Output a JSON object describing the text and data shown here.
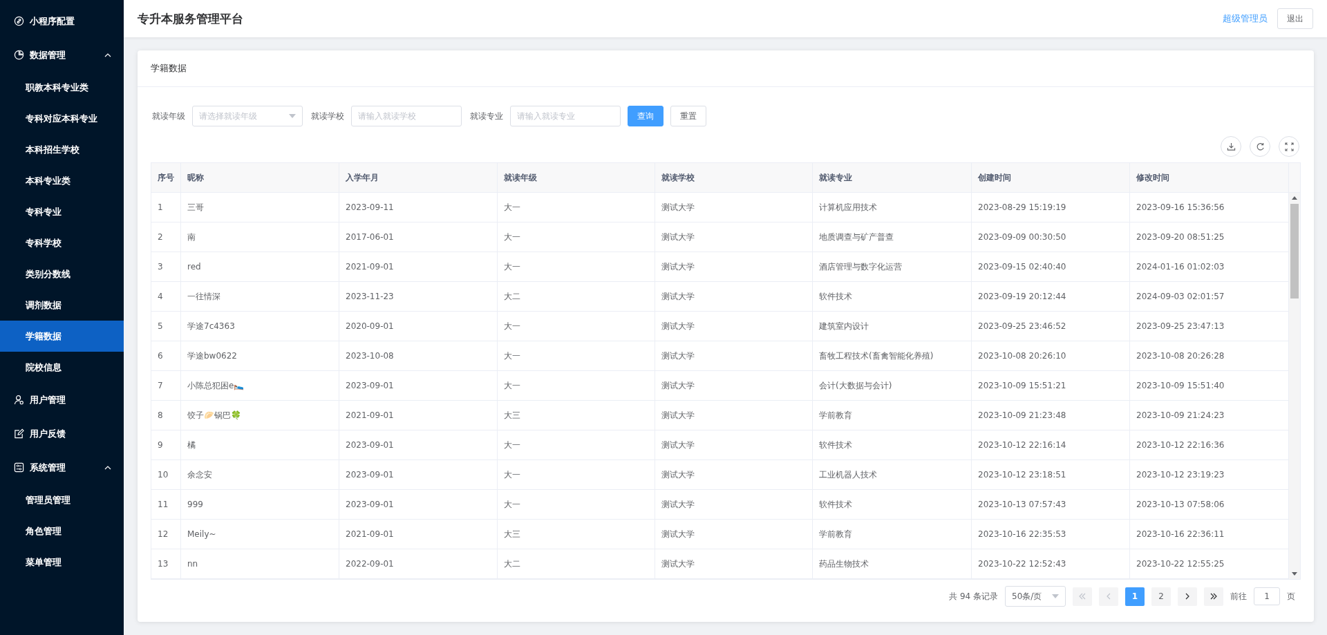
{
  "sidebar": {
    "items": [
      {
        "label": "小程序配置"
      },
      {
        "label": "数据管理",
        "expanded": true,
        "children": [
          {
            "label": "职教本科专业类",
            "selected": false
          },
          {
            "label": "专科对应本科专业",
            "selected": false
          },
          {
            "label": "本科招生学校",
            "selected": false
          },
          {
            "label": "本科专业类",
            "selected": false
          },
          {
            "label": "专科专业",
            "selected": false
          },
          {
            "label": "专科学校",
            "selected": false
          },
          {
            "label": "类别分数线",
            "selected": false
          },
          {
            "label": "调剂数据",
            "selected": false
          },
          {
            "label": "学籍数据",
            "selected": true
          },
          {
            "label": "院校信息",
            "selected": false
          }
        ]
      },
      {
        "label": "用户管理"
      },
      {
        "label": "用户反馈"
      },
      {
        "label": "系统管理",
        "expanded": true,
        "children": [
          {
            "label": "管理员管理",
            "selected": false
          },
          {
            "label": "角色管理",
            "selected": false
          },
          {
            "label": "菜单管理",
            "selected": false
          }
        ]
      }
    ]
  },
  "header": {
    "title": "专升本服务管理平台",
    "user": "超级管理员",
    "logout": "退出"
  },
  "card": {
    "title": "学籍数据"
  },
  "filters": [
    {
      "kind": "select",
      "label": "就读年级",
      "placeholder": "请选择就读年级"
    },
    {
      "kind": "input",
      "label": "就读学校",
      "placeholder": "请输入就读学校"
    },
    {
      "kind": "input",
      "label": "就读专业",
      "placeholder": "请输入就读专业"
    }
  ],
  "buttons": [
    {
      "label": "查询",
      "primary": true
    },
    {
      "label": "重置",
      "primary": false
    }
  ],
  "table": {
    "columns": [
      "序号",
      "昵称",
      "入学年月",
      "就读年级",
      "就读学校",
      "就读专业",
      "创建时间",
      "修改时间"
    ],
    "rows": [
      [
        "1",
        "三哥",
        "2023-09-11",
        "大一",
        "测试大学",
        "计算机应用技术",
        "2023-08-29 15:19:19",
        "2023-09-16 15:36:56"
      ],
      [
        "2",
        "南",
        "2017-06-01",
        "大一",
        "测试大学",
        "地质调查与矿产普查",
        "2023-09-09 00:30:50",
        "2023-09-20 08:51:25"
      ],
      [
        "3",
        "red",
        "2021-09-01",
        "大一",
        "测试大学",
        "酒店管理与数字化运营",
        "2023-09-15 02:40:40",
        "2024-01-16 01:02:03"
      ],
      [
        "4",
        "一往情深",
        "2023-11-23",
        "大二",
        "测试大学",
        "软件技术",
        "2023-09-19 20:12:44",
        "2024-09-03 02:01:57"
      ],
      [
        "5",
        "学途7c4363",
        "2020-09-01",
        "大一",
        "测试大学",
        "建筑室内设计",
        "2023-09-25 23:46:52",
        "2023-09-25 23:47:13"
      ],
      [
        "6",
        "学途bw0622",
        "2023-10-08",
        "大一",
        "测试大学",
        "畜牧工程技术(畜禽智能化养殖)",
        "2023-10-08 20:26:10",
        "2023-10-08 20:26:28"
      ],
      [
        "7",
        "小陈总犯困e🛌",
        "2023-09-01",
        "大一",
        "测试大学",
        "会计(大数据与会计)",
        "2023-10-09 15:51:21",
        "2023-10-09 15:51:40"
      ],
      [
        "8",
        "饺子🥟锅巴🍀",
        "2021-09-01",
        "大三",
        "测试大学",
        "学前教育",
        "2023-10-09 21:23:48",
        "2023-10-09 21:24:23"
      ],
      [
        "9",
        "橘",
        "2023-09-01",
        "大一",
        "测试大学",
        "软件技术",
        "2023-10-12 22:16:14",
        "2023-10-12 22:16:36"
      ],
      [
        "10",
        "余念安",
        "2023-09-01",
        "大一",
        "测试大学",
        "工业机器人技术",
        "2023-10-12 23:18:51",
        "2023-10-12 23:19:23"
      ],
      [
        "11",
        "999",
        "2023-09-01",
        "大一",
        "测试大学",
        "软件技术",
        "2023-10-13 07:57:43",
        "2023-10-13 07:58:06"
      ],
      [
        "12",
        "Meily~",
        "2021-09-01",
        "大三",
        "测试大学",
        "学前教育",
        "2023-10-16 22:35:53",
        "2023-10-16 22:36:11"
      ],
      [
        "13",
        "nn",
        "2022-09-01",
        "大二",
        "测试大学",
        "药品生物技术",
        "2023-10-22 12:52:43",
        "2023-10-22 12:55:25"
      ]
    ]
  },
  "pagination": {
    "total": "共 94 条记录",
    "page_size": "50条/页",
    "pages": [
      {
        "label": "1",
        "selected": true
      },
      {
        "label": "2",
        "selected": false
      }
    ],
    "goto_label": "前往",
    "goto_value": "1",
    "page_suffix": "页"
  }
}
